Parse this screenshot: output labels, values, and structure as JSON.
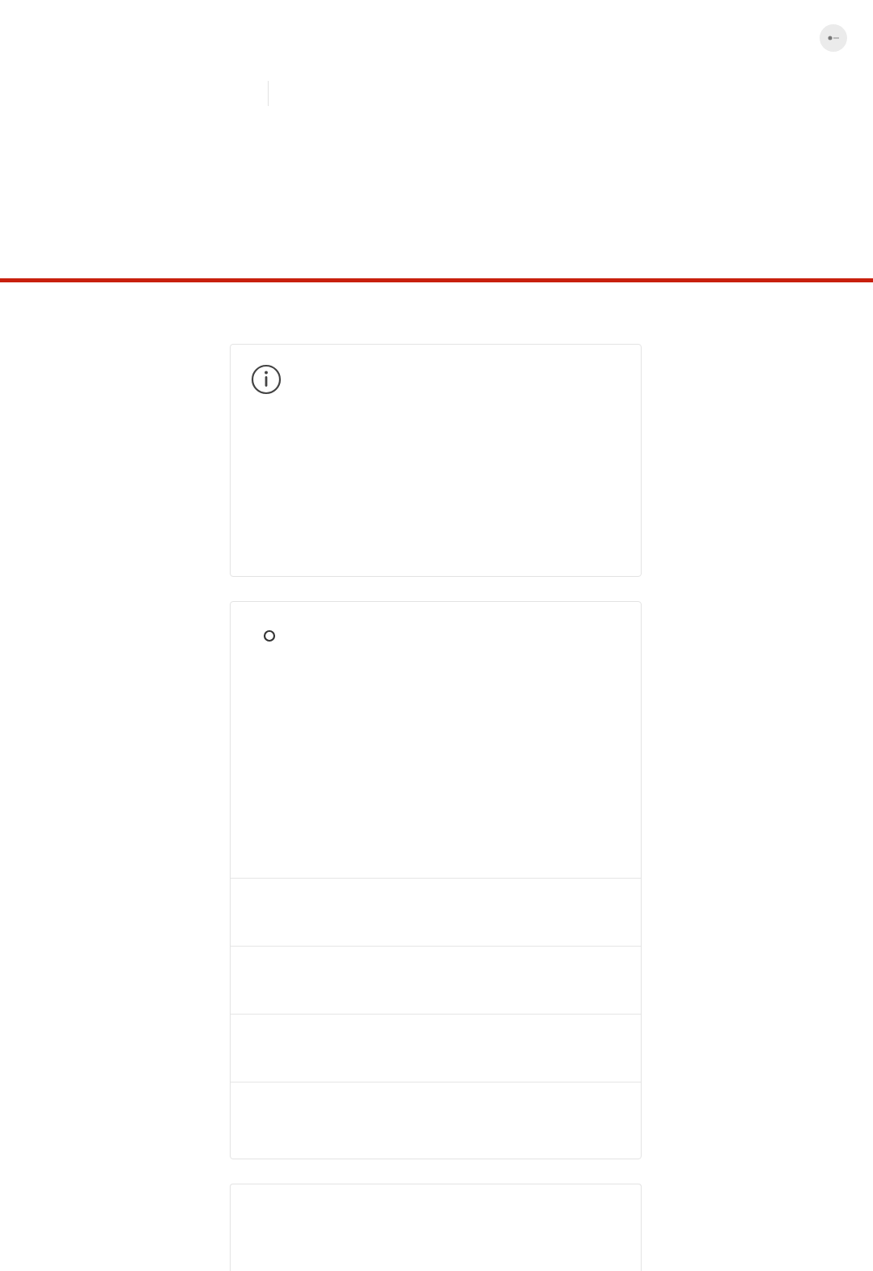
{
  "cards": [
    {
      "kind": "info"
    },
    {
      "kind": "list"
    },
    {
      "kind": "plain"
    }
  ]
}
